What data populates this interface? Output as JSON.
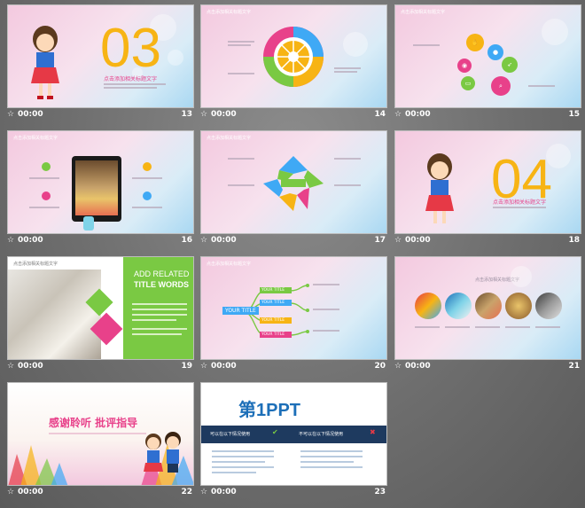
{
  "slides": [
    {
      "num": "13",
      "time": "00:00",
      "title": "点击添加相关标题文字",
      "bignum": "03"
    },
    {
      "num": "14",
      "time": "00:00",
      "title": "点击添加相关标题文字"
    },
    {
      "num": "15",
      "time": "00:00",
      "title": "点击添加相关标题文字"
    },
    {
      "num": "16",
      "time": "00:00",
      "title": "点击添加相关标题文字"
    },
    {
      "num": "17",
      "time": "00:00",
      "title": "点击添加相关标题文字"
    },
    {
      "num": "18",
      "time": "00:00",
      "title": "点击添加相关标题文字",
      "bignum": "04"
    },
    {
      "num": "19",
      "time": "00:00",
      "title": "点击添加相关标题文字",
      "heading1": "ADD RELATED",
      "heading2": "TITLE WORDS"
    },
    {
      "num": "20",
      "time": "00:00",
      "title": "点击添加相关标题文字",
      "center": "YOUR TITLE",
      "items": [
        "YOUR TITLE",
        "YOUR TITLE",
        "YOUR TITLE",
        "YOUR TITLE"
      ]
    },
    {
      "num": "21",
      "time": "00:00",
      "title": "点击添加相关标题文字"
    },
    {
      "num": "22",
      "time": "00:00",
      "title": "感谢聆听 批评指导"
    },
    {
      "num": "23",
      "time": "00:00",
      "brand": "第1PPT",
      "left_head": "可以在以下情况使用",
      "right_head": "不可以在以下情况使用"
    }
  ],
  "colors": {
    "accent_yellow": "#f7b414",
    "accent_pink": "#e8418a",
    "accent_green": "#7ac943",
    "accent_blue": "#3fa9f5"
  }
}
